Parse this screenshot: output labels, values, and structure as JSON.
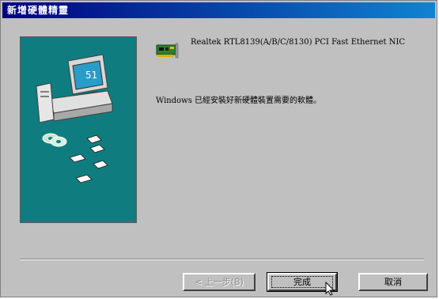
{
  "window": {
    "title": "新增硬體精靈"
  },
  "device": {
    "icon": "network-card-icon",
    "name": "Realtek RTL8139(A/B/C/8130) PCI Fast Ethernet NIC"
  },
  "message": "Windows 已經安裝好新硬體裝置需要的軟體。",
  "buttons": {
    "back_label": "< 上一步(B)",
    "finish_label": "完成",
    "cancel_label": "取消"
  },
  "colors": {
    "title_bar_start": "#000080",
    "title_bar_end": "#1084d0",
    "window_face": "#c0c0c0",
    "side_panel": "#0f7d80"
  }
}
